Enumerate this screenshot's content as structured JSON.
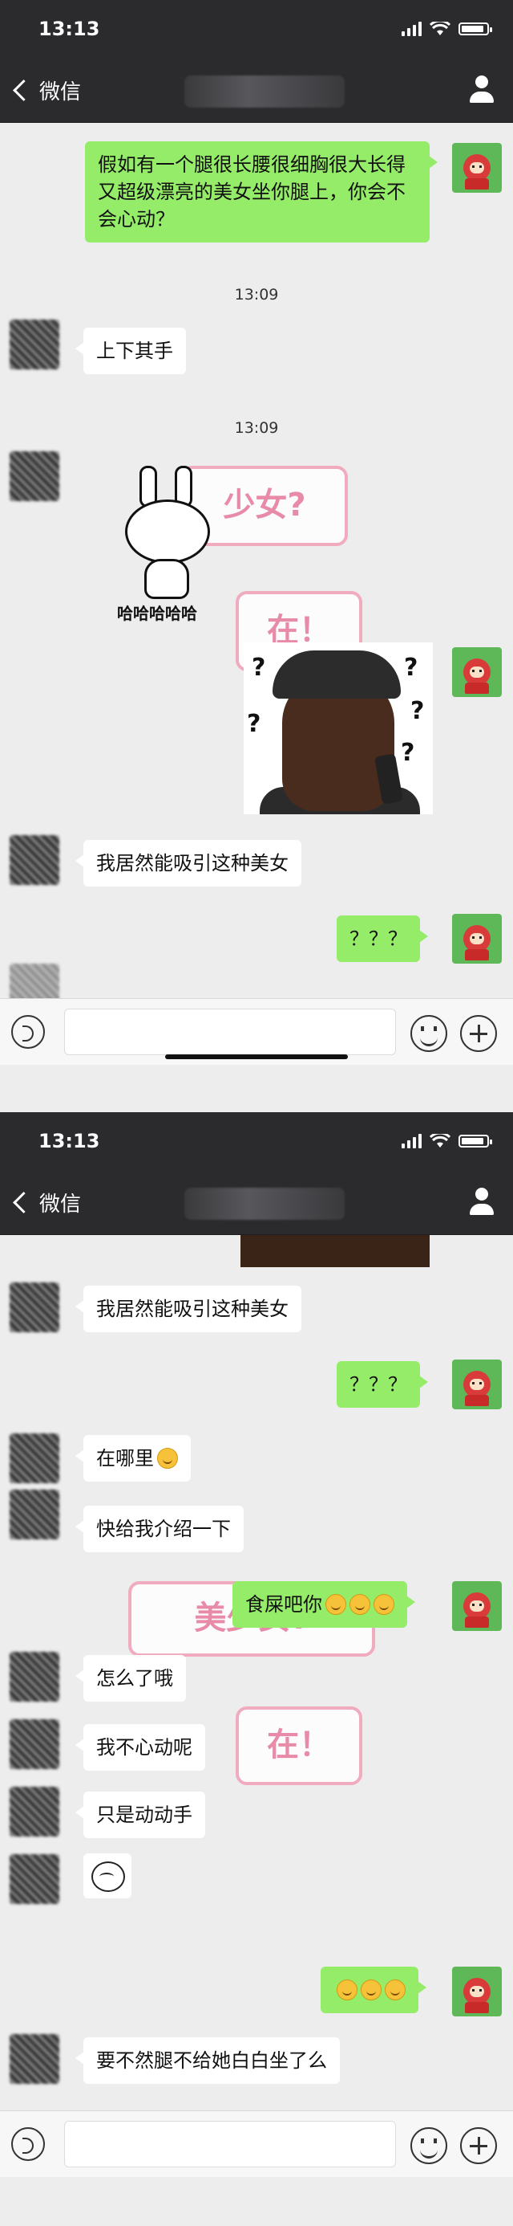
{
  "status_bar": {
    "time": "13:13"
  },
  "nav": {
    "back_label": "微信"
  },
  "screen1": {
    "messages": {
      "m1": "假如有一个腿很长腰很细胸很大长得又超级漂亮的美女坐你腿上，你会不会心动？",
      "ts1": "13:09",
      "m2": "上下其手",
      "ts2": "13:09",
      "sticker_rabbit_text": "哈哈哈哈哈",
      "card_a": "少女?",
      "card_b": "在！",
      "m3": "我居然能吸引这种美女",
      "m4": "？？？"
    }
  },
  "screen2": {
    "messages": {
      "m1": "我居然能吸引这种美女",
      "m2": "？？？",
      "m3": "在哪里",
      "m4": "快给我介绍一下",
      "m5": "食屎吧你",
      "card_a": "美少女?",
      "m6": "怎么了哦",
      "m7": "我不心动呢",
      "card_b": "在！",
      "m8": "只是动动手",
      "m9": "要不然腿不给她白白坐了么"
    }
  },
  "icons": [
    "back-chevron-icon",
    "contact-person-icon",
    "voice-icon",
    "emoji-icon",
    "plus-icon",
    "signal-icon",
    "wifi-icon",
    "battery-icon"
  ],
  "colors": {
    "bar": "#2b2b2e",
    "bubble_out": "#95ec69",
    "bubble_in": "#ffffff",
    "background": "#ededed"
  }
}
